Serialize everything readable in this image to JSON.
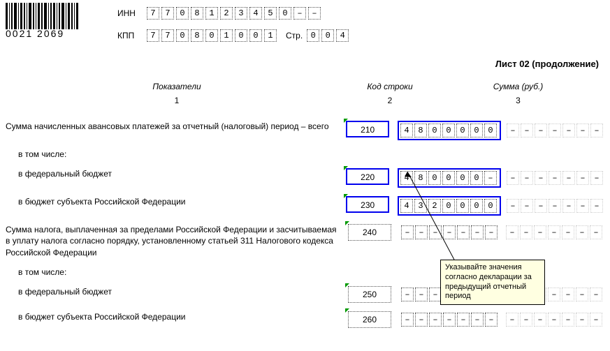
{
  "barcode_number": "0021 2069",
  "inn_label": "ИНН",
  "kpp_label": "КПП",
  "page_label": "Стр.",
  "inn_cells": [
    "7",
    "7",
    "0",
    "8",
    "1",
    "2",
    "3",
    "4",
    "5",
    "0",
    "–",
    "–"
  ],
  "kpp_cells": [
    "7",
    "7",
    "0",
    "8",
    "0",
    "1",
    "0",
    "0",
    "1"
  ],
  "page_cells": [
    "0",
    "0",
    "4"
  ],
  "sheet_title": "Лист 02 (продолжение)",
  "col_headers": {
    "indicator": "Показатели",
    "code": "Код строки",
    "sum": "Сумма (руб.)"
  },
  "col_nums": {
    "indicator": "1",
    "code": "2",
    "sum": "3"
  },
  "rows": {
    "r210": {
      "label": "Сумма начисленных авансовых платежей за отчетный (налоговый) период – всего",
      "code": "210",
      "value": [
        "4",
        "8",
        "0",
        "0",
        "0",
        "0",
        "0"
      ]
    },
    "including": "в том числе:",
    "r220": {
      "label": "в федеральный бюджет",
      "code": "220",
      "value": [
        "4",
        "8",
        "0",
        "0",
        "0",
        "0",
        "–"
      ]
    },
    "r230": {
      "label": "в бюджет субъекта Российской Федерации",
      "code": "230",
      "value": [
        "4",
        "3",
        "2",
        "0",
        "0",
        "0",
        "0"
      ]
    },
    "r240": {
      "label": "Сумма налога, выплаченная за пределами Российской Федерации и засчитываемая в уплату налога согласно порядку, установленному статьей 311 Налогового кодекса Российской Федерации",
      "code": "240",
      "value": [
        "–",
        "–",
        "–",
        "–",
        "–",
        "–",
        "–"
      ]
    },
    "r250": {
      "label": "в федеральный бюджет",
      "code": "250",
      "value": [
        "–",
        "–",
        "–",
        "–",
        "–",
        "–",
        "–"
      ]
    },
    "r260": {
      "label": "в бюджет субъекта Российской Федерации",
      "code": "260",
      "value": [
        "–",
        "–",
        "–",
        "–",
        "–",
        "–",
        "–"
      ]
    }
  },
  "tooltip_text": "Указывайте значения согласно декларации за предыдущий отчетный период"
}
